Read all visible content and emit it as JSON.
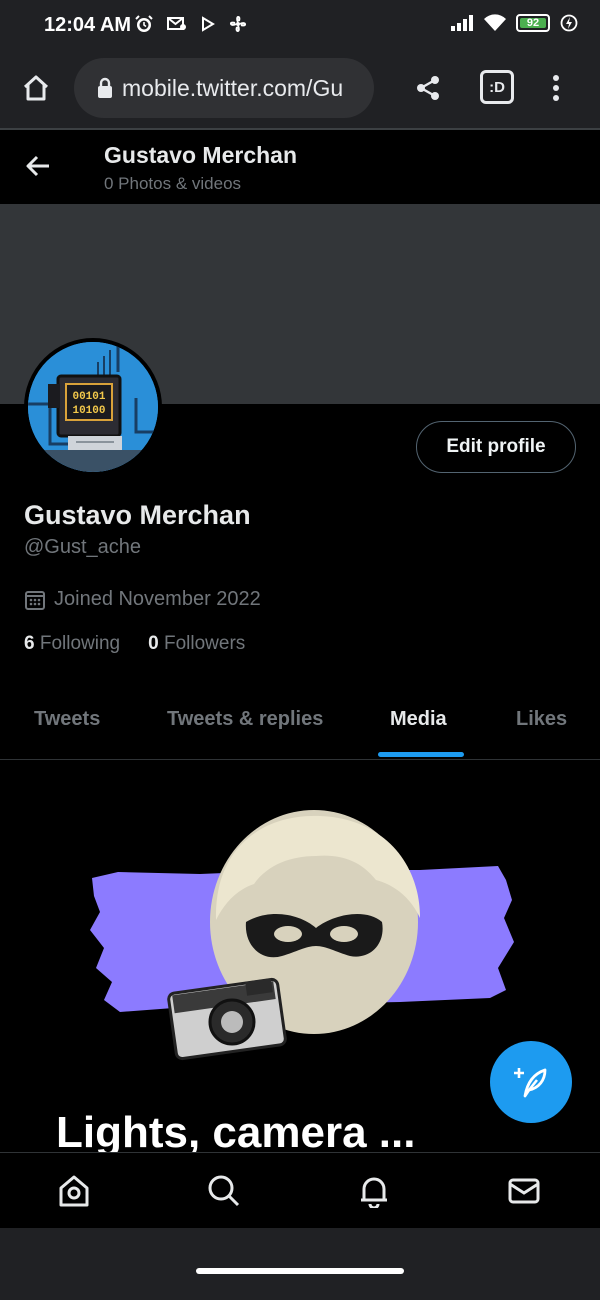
{
  "statusbar": {
    "time": "12:04 AM",
    "battery_level": "92",
    "icons": [
      "alarm-icon",
      "mail-notification-icon",
      "play-icon",
      "fan-icon",
      "signal-icon",
      "wifi-icon",
      "battery-icon",
      "charging-icon"
    ]
  },
  "browser": {
    "url": "mobile.twitter.com/Gu",
    "icons": [
      "home-icon",
      "lock-icon",
      "share-icon",
      "tab-switcher-icon",
      "more-vertical-icon"
    ],
    "tab_badge": ":D"
  },
  "header": {
    "name": "Gustavo Merchan",
    "subtitle": "0 Photos & videos"
  },
  "profile": {
    "name": "Gustavo Merchan",
    "handle": "@Gust_ache",
    "joined": "Joined November 2022",
    "following_count": "6",
    "following_label": "Following",
    "followers_count": "0",
    "followers_label": "Followers",
    "edit_label": "Edit profile",
    "avatar_text_1": "00101",
    "avatar_text_2": "10100"
  },
  "tabs": [
    {
      "label": "Tweets",
      "active": false
    },
    {
      "label": "Tweets & replies",
      "active": false
    },
    {
      "label": "Media",
      "active": true
    },
    {
      "label": "Likes",
      "active": false
    }
  ],
  "media": {
    "title": "Lights, camera ..."
  },
  "bottom_nav": [
    "home-icon",
    "search-icon",
    "bell-icon",
    "mail-icon"
  ],
  "colors": {
    "accent": "#1d9bf0",
    "banner": "#333639",
    "purple_brush": "#8c7bff"
  }
}
